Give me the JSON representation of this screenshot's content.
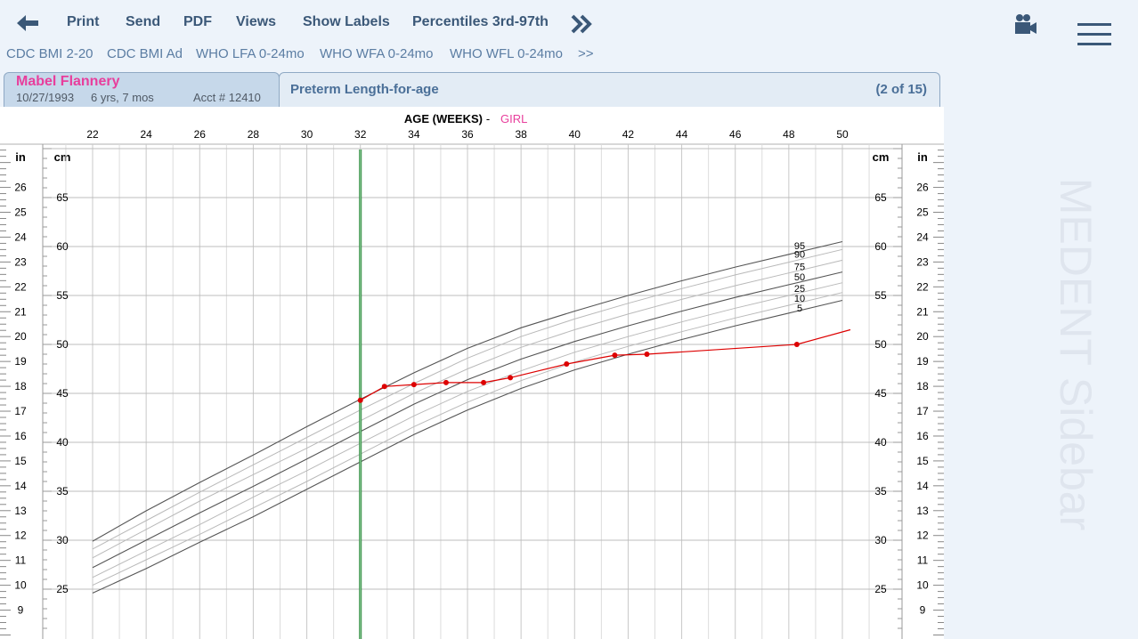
{
  "toolbar": {
    "print": "Print",
    "send": "Send",
    "pdf": "PDF",
    "views": "Views",
    "show_labels": "Show Labels",
    "percentiles": "Percentiles 3rd-97th"
  },
  "chart_types": {
    "items": [
      "CDC BMI 2-20",
      "CDC BMI Ad",
      "WHO LFA 0-24mo",
      "WHO WFA 0-24mo",
      "WHO WFL 0-24mo"
    ],
    "more": ">>"
  },
  "patient": {
    "name": "Mabel Flannery",
    "dob": "10/27/1993",
    "age": "6 yrs, 7 mos",
    "acct": "Acct # 12410"
  },
  "chart_tab": {
    "title": "Preterm Length-for-age",
    "count": "(2 of 15)"
  },
  "sidebar": {
    "watermark": "MEDENT Sidebar",
    "icons": [
      "camera-icon",
      "hamburger-menu-icon"
    ]
  },
  "colors": {
    "accent": "#3b5878",
    "patient_name": "#e83e9c",
    "measurement_series": "#dd0000",
    "current_age_line": "#2e8b3e"
  },
  "chart_data": {
    "type": "line",
    "title_label": "AGE (WEEKS)",
    "title_separator": "-",
    "sex": "GIRL",
    "x_range": [
      21,
      51
    ],
    "x_ticks": [
      22,
      24,
      26,
      28,
      30,
      32,
      34,
      36,
      38,
      40,
      42,
      44,
      46,
      48,
      50
    ],
    "y_cm_range": [
      21,
      70
    ],
    "cm_label": "cm",
    "in_label": "in",
    "cm_ticks": [
      25,
      30,
      35,
      40,
      45,
      50,
      55,
      60,
      65
    ],
    "in_ticks": [
      9,
      10,
      11,
      12,
      13,
      14,
      15,
      16,
      17,
      18,
      19,
      20,
      21,
      22,
      23,
      24,
      25,
      26
    ],
    "current_age_weeks": 32,
    "grid": true,
    "percentiles": [
      {
        "name": "95",
        "x": [
          22,
          24,
          26,
          28,
          30,
          32,
          34,
          36,
          38,
          40,
          42,
          44,
          46,
          48,
          50
        ],
        "y": [
          29.9,
          33.0,
          35.9,
          38.7,
          41.6,
          44.4,
          47.1,
          49.6,
          51.7,
          53.4,
          55.0,
          56.5,
          57.9,
          59.2,
          60.5
        ]
      },
      {
        "name": "90",
        "x": [
          22,
          24,
          26,
          28,
          30,
          32,
          34,
          36,
          38,
          40,
          42,
          44,
          46,
          48,
          50
        ],
        "y": [
          29.1,
          32.0,
          34.9,
          37.7,
          40.5,
          43.3,
          46.0,
          48.6,
          50.8,
          52.6,
          54.2,
          55.7,
          57.1,
          58.4,
          59.7
        ]
      },
      {
        "name": "75",
        "x": [
          22,
          24,
          26,
          28,
          30,
          32,
          34,
          36,
          38,
          40,
          42,
          44,
          46,
          48,
          50
        ],
        "y": [
          28.2,
          31.1,
          34.0,
          36.7,
          39.4,
          42.2,
          45.0,
          47.5,
          49.7,
          51.5,
          53.1,
          54.6,
          56.0,
          57.3,
          58.6
        ]
      },
      {
        "name": "50",
        "x": [
          22,
          24,
          26,
          28,
          30,
          32,
          34,
          36,
          38,
          40,
          42,
          44,
          46,
          48,
          50
        ],
        "y": [
          27.2,
          30.0,
          32.8,
          35.5,
          38.3,
          41.1,
          43.9,
          46.4,
          48.5,
          50.3,
          51.9,
          53.4,
          54.8,
          56.1,
          57.4
        ]
      },
      {
        "name": "25",
        "x": [
          22,
          24,
          26,
          28,
          30,
          32,
          34,
          36,
          38,
          40,
          42,
          44,
          46,
          48,
          50
        ],
        "y": [
          26.2,
          28.9,
          31.6,
          34.4,
          37.1,
          39.9,
          42.7,
          45.2,
          47.3,
          49.2,
          50.8,
          52.3,
          53.7,
          55.0,
          56.3
        ]
      },
      {
        "name": "10",
        "x": [
          22,
          24,
          26,
          28,
          30,
          32,
          34,
          36,
          38,
          40,
          42,
          44,
          46,
          48,
          50
        ],
        "y": [
          25.4,
          28.0,
          30.6,
          33.3,
          36.0,
          38.8,
          41.6,
          44.1,
          46.3,
          48.2,
          49.8,
          51.3,
          52.7,
          54.0,
          55.3
        ]
      },
      {
        "name": "5",
        "x": [
          22,
          24,
          26,
          28,
          30,
          32,
          34,
          36,
          38,
          40,
          42,
          44,
          46,
          48,
          50
        ],
        "y": [
          24.6,
          27.1,
          29.8,
          32.4,
          35.2,
          38.0,
          40.8,
          43.3,
          45.5,
          47.4,
          49.0,
          50.5,
          51.9,
          53.2,
          54.5
        ]
      }
    ],
    "measurements": {
      "x": [
        32.0,
        32.9,
        34.0,
        35.2,
        36.6,
        37.6,
        39.7,
        41.5,
        42.7,
        48.3,
        50.3
      ],
      "y": [
        44.3,
        45.7,
        45.9,
        46.1,
        46.1,
        46.6,
        48.0,
        48.9,
        49.0,
        50.0,
        51.5
      ],
      "point_count": 10
    }
  }
}
